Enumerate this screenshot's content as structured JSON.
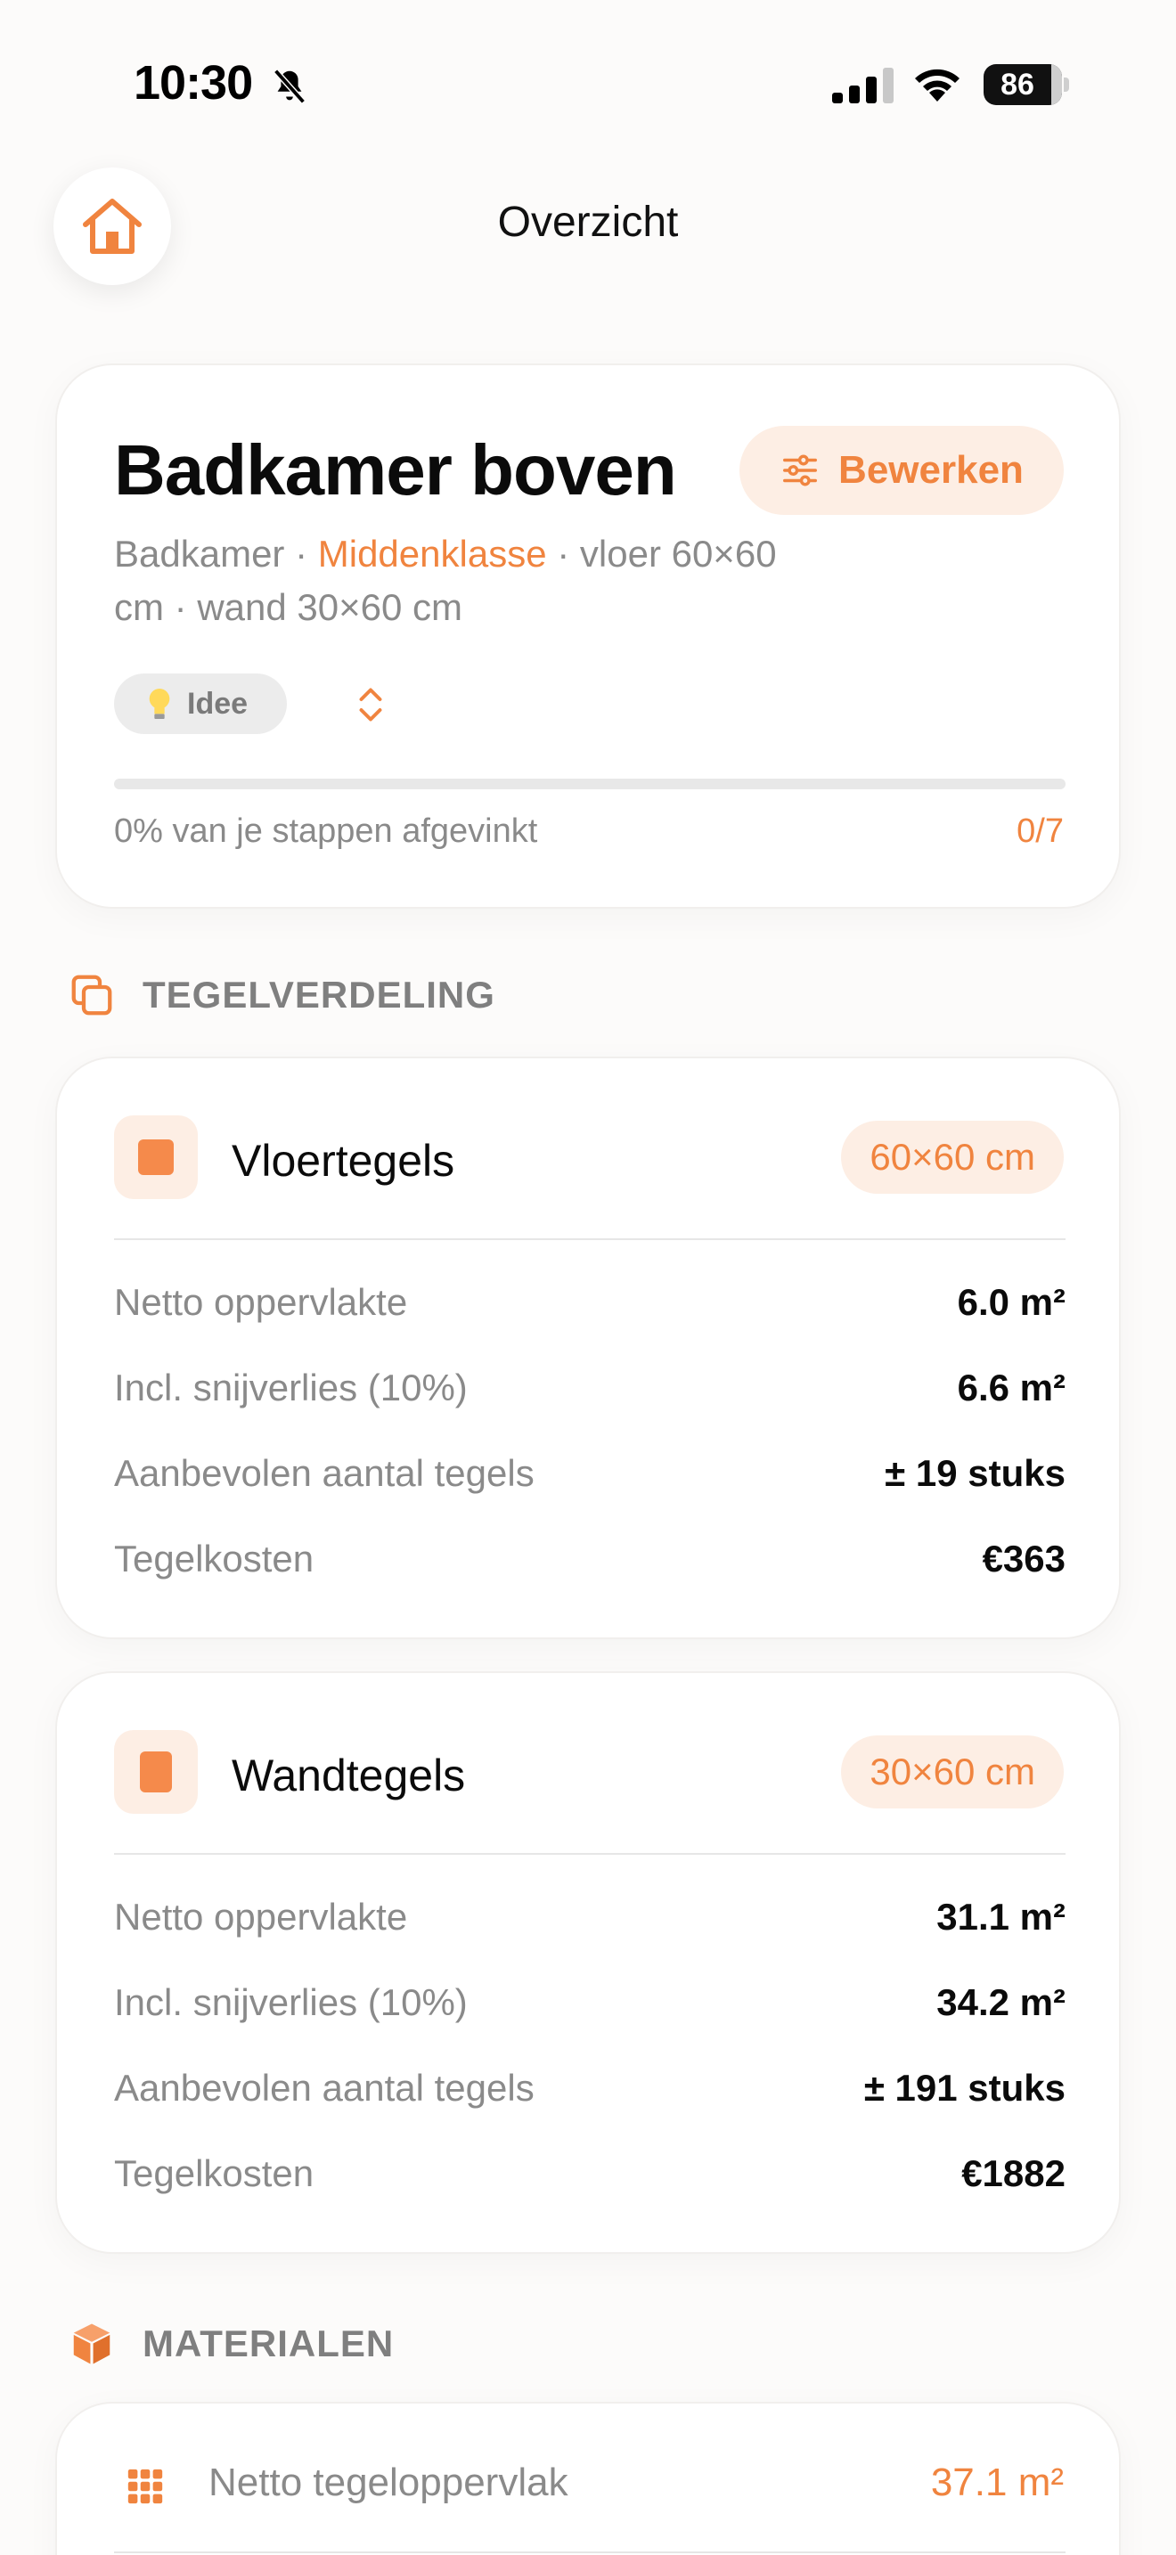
{
  "status_bar": {
    "time": "10:30",
    "battery": "86",
    "icons": [
      "bell-slash-icon",
      "cellular-signal-icon",
      "wifi-icon",
      "battery-icon"
    ]
  },
  "nav": {
    "title": "Overzicht",
    "home_icon": "home-icon"
  },
  "project": {
    "title": "Badkamer boven",
    "edit_label": "Bewerken",
    "room_type": "Badkamer",
    "separator": " · ",
    "quality": "Middenklasse",
    "floor_spec": "vloer 60×60 cm",
    "wall_spec": "wand 30×60 cm",
    "status_label": "Idee",
    "progress_fraction": 0,
    "progress_text": "0% van je stappen afgevinkt",
    "progress_count": "0/7"
  },
  "sections": {
    "tile_distribution": "TEGELVERDELING",
    "materials": "MATERIALEN"
  },
  "floor_tiles": {
    "title": "Vloertegels",
    "size": "60×60 cm",
    "rows": [
      {
        "label": "Netto oppervlakte",
        "value": "6.0 m²"
      },
      {
        "label": "Incl. snijverlies (10%)",
        "value": "6.6 m²"
      },
      {
        "label": "Aanbevolen aantal tegels",
        "value": "± 19 stuks"
      },
      {
        "label": "Tegelkosten",
        "value": "€363"
      }
    ]
  },
  "wall_tiles": {
    "title": "Wandtegels",
    "size": "30×60 cm",
    "rows": [
      {
        "label": "Netto oppervlakte",
        "value": "31.1 m²"
      },
      {
        "label": "Incl. snijverlies (10%)",
        "value": "34.2 m²"
      },
      {
        "label": "Aanbevolen aantal tegels",
        "value": "± 191 stuks"
      },
      {
        "label": "Tegelkosten",
        "value": "€1882"
      }
    ]
  },
  "materials": {
    "net_area_label": "Netto tegeloppervlak",
    "net_area_value": "37.1 m²"
  },
  "colors": {
    "accent": "#f0843f",
    "accent_soft": "#fdeee4",
    "text_muted": "#8a8a8a",
    "background": "#fcfbfa"
  }
}
